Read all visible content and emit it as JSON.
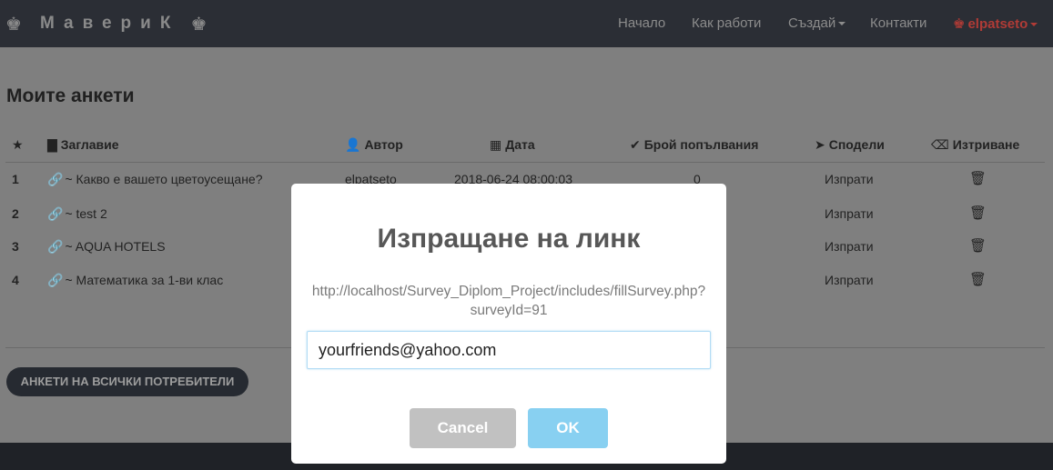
{
  "navbar": {
    "brand": "МавериК",
    "brand_icon_left": "♚",
    "brand_icon_right": "♚",
    "items": {
      "home": "Начало",
      "how": "Как работи",
      "create": "Създай",
      "contacts": "Контакти",
      "user": "elpatseto",
      "user_icon": "♚"
    }
  },
  "page": {
    "title": "Моите анкети"
  },
  "table": {
    "headers": {
      "star": "★",
      "title": "Заглавие",
      "author": "Автор",
      "date": "Дата",
      "fills": "Брой попълвания",
      "share": "Сподели",
      "delete": "Изтриване"
    },
    "header_icons": {
      "title": "▇",
      "author": "👤",
      "date": "▦",
      "fills": "✔",
      "share": "➤",
      "delete": "⌫"
    },
    "rows": [
      {
        "num": "1",
        "title": "~ Какво е вашето цветоусещане?",
        "author": "elpatseto",
        "date": "2018-06-24 08:00:03",
        "fills": "0",
        "share": "Изпрати"
      },
      {
        "num": "2",
        "title": "~ test 2",
        "author": "",
        "date": "",
        "fills": "",
        "share": "Изпрати"
      },
      {
        "num": "3",
        "title": "~ AQUA HOTELS",
        "author": "",
        "date": "",
        "fills": "",
        "share": "Изпрати"
      },
      {
        "num": "4",
        "title": "~ Математика за 1-ви клас",
        "author": "",
        "date": "",
        "fills": "",
        "share": "Изпрати"
      }
    ],
    "link_icon": "🔗",
    "delete_icon": "🗑"
  },
  "buttons": {
    "all_surveys": "АНКЕТИ НА ВСИЧКИ ПОТРЕБИТЕЛИ"
  },
  "modal": {
    "title": "Изпращане на линк",
    "url_line1": "http://localhost/Survey_Diplom_Project/includes/fillSurvey.php?",
    "url_line2": "surveyId=91",
    "input_value": "yourfriends@yahoo.com",
    "cancel": "Cancel",
    "ok": "OK"
  },
  "colors": {
    "navbar_bg": "#2b2e35",
    "overlay": "#7f7f7f",
    "user_accent": "#b03b36",
    "ok_button": "#88d0f1",
    "cancel_button": "#c1c1c1"
  }
}
